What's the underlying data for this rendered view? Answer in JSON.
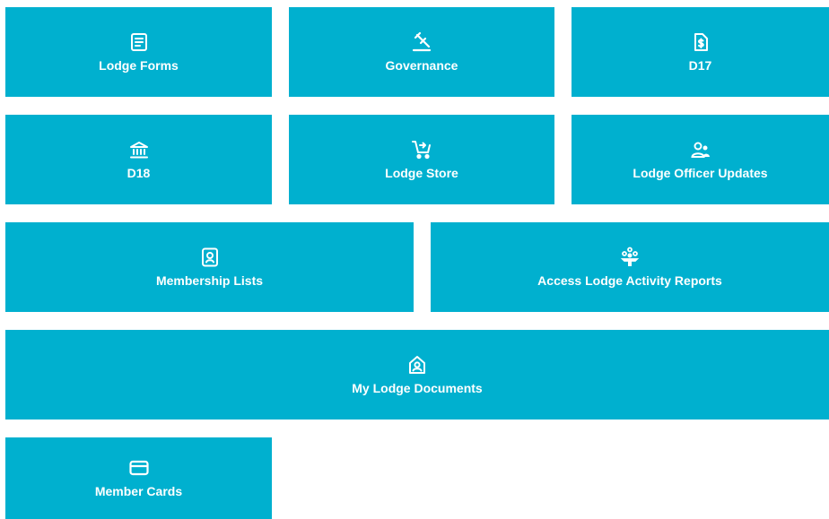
{
  "theme": {
    "tile_color": "#00b0cf",
    "text_color": "#ffffff",
    "background": "#ffffff"
  },
  "tiles": [
    {
      "label": "Lodge Forms",
      "icon": "form-icon"
    },
    {
      "label": "Governance",
      "icon": "gavel-icon"
    },
    {
      "label": "D17",
      "icon": "dollar-document-icon"
    },
    {
      "label": "D18",
      "icon": "bank-icon"
    },
    {
      "label": "Lodge Store",
      "icon": "cart-icon"
    },
    {
      "label": "Lodge Officer Updates",
      "icon": "people-icon"
    },
    {
      "label": "Membership Lists",
      "icon": "id-badge-icon"
    },
    {
      "label": "Access Lodge Activity Reports",
      "icon": "activity-report-icon"
    },
    {
      "label": "My Lodge Documents",
      "icon": "lodge-document-icon"
    },
    {
      "label": "Member Cards",
      "icon": "credit-card-icon"
    }
  ]
}
